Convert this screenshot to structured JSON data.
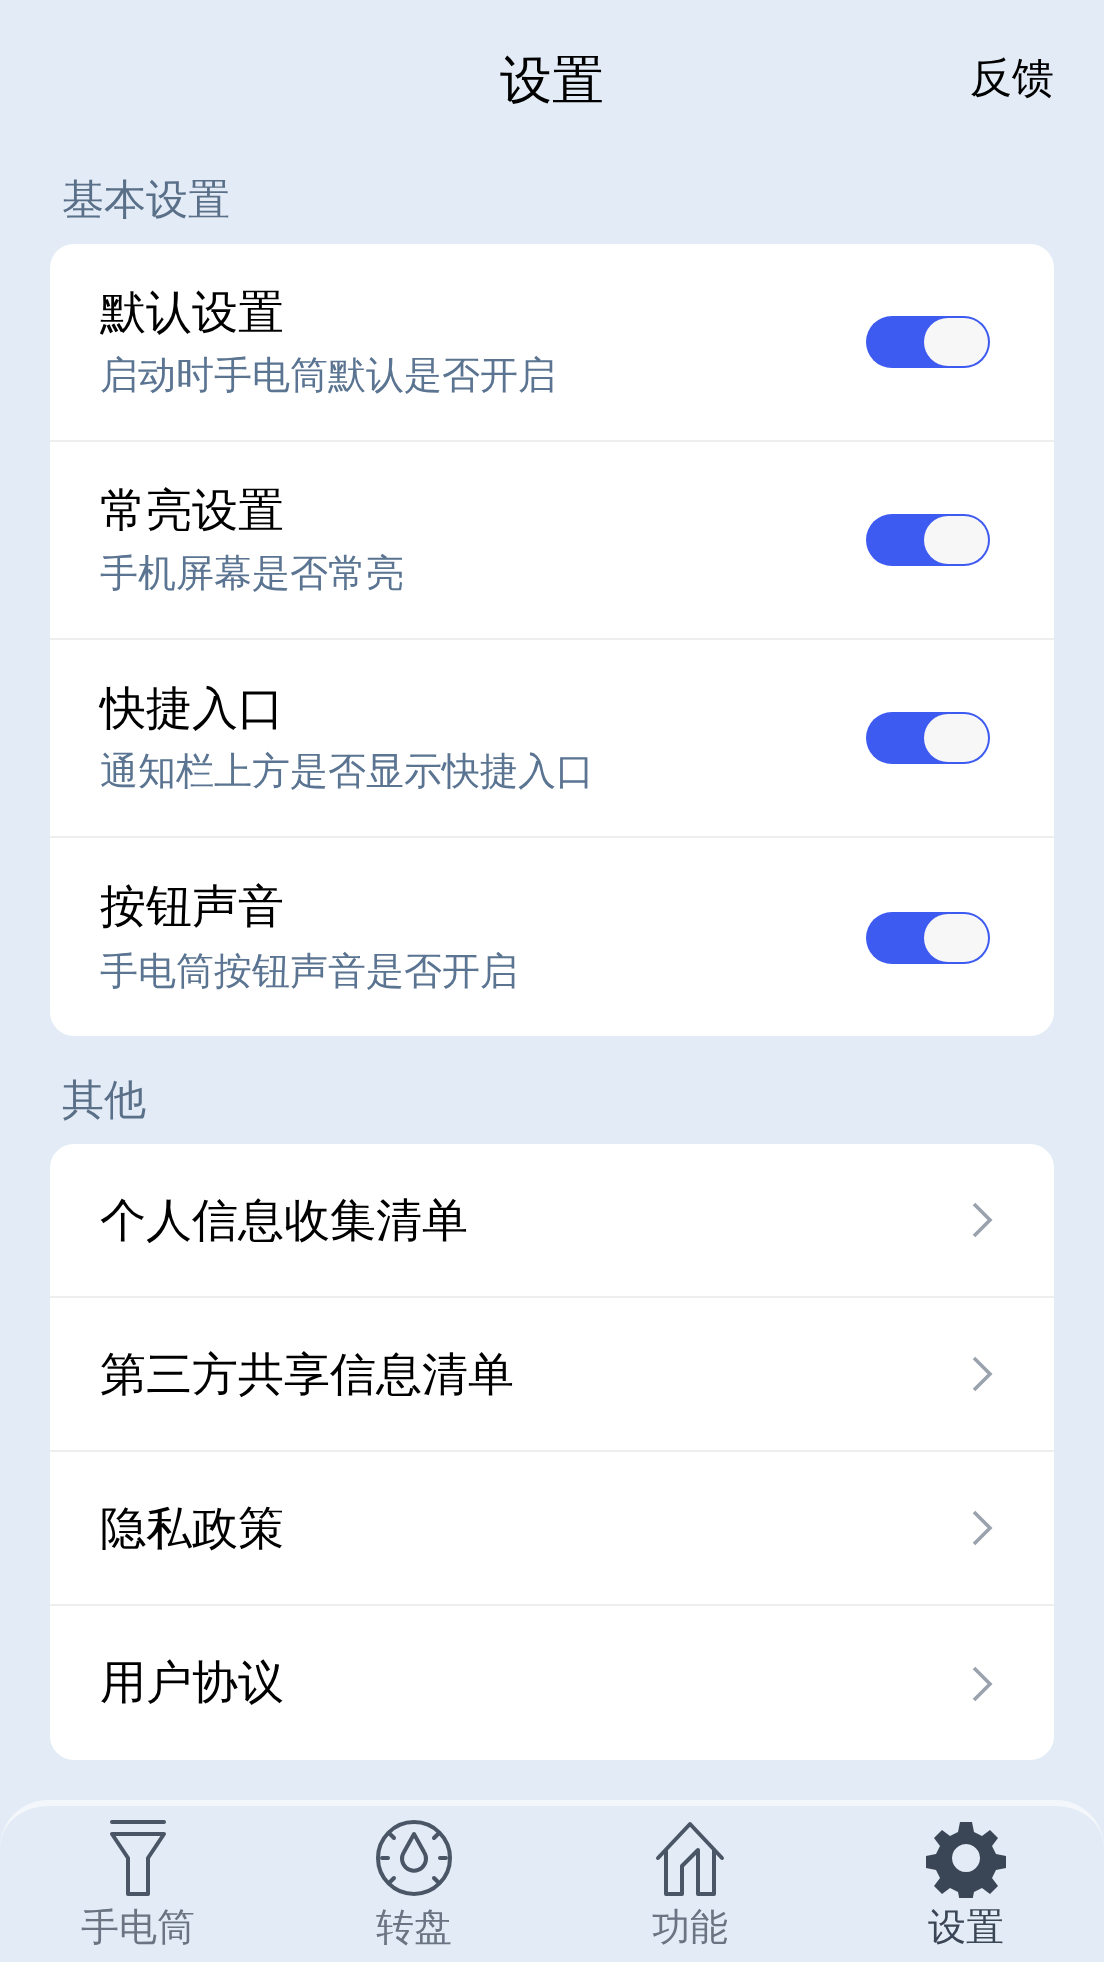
{
  "header": {
    "title": "设置",
    "action": "反馈"
  },
  "sections": [
    {
      "title": "基本设置",
      "items": [
        {
          "kind": "toggle",
          "label": "默认设置",
          "description": "启动时手电筒默认是否开启",
          "on": true
        },
        {
          "kind": "toggle",
          "label": "常亮设置",
          "description": "手机屏幕是否常亮",
          "on": true
        },
        {
          "kind": "toggle",
          "label": "快捷入口",
          "description": "通知栏上方是否显示快捷入口",
          "on": true
        },
        {
          "kind": "toggle",
          "label": "按钮声音",
          "description": "手电筒按钮声音是否开启",
          "on": true
        }
      ]
    },
    {
      "title": "其他",
      "items": [
        {
          "kind": "link",
          "label": "个人信息收集清单"
        },
        {
          "kind": "link",
          "label": "第三方共享信息清单"
        },
        {
          "kind": "link",
          "label": "隐私政策"
        },
        {
          "kind": "link",
          "label": "用户协议"
        }
      ]
    }
  ],
  "tabs": [
    {
      "kind": "flashlight",
      "label": "手电筒",
      "selected": false
    },
    {
      "kind": "dial",
      "label": "转盘",
      "selected": false
    },
    {
      "kind": "home",
      "label": "功能",
      "selected": false
    },
    {
      "kind": "gear",
      "label": "设置",
      "selected": true
    }
  ]
}
